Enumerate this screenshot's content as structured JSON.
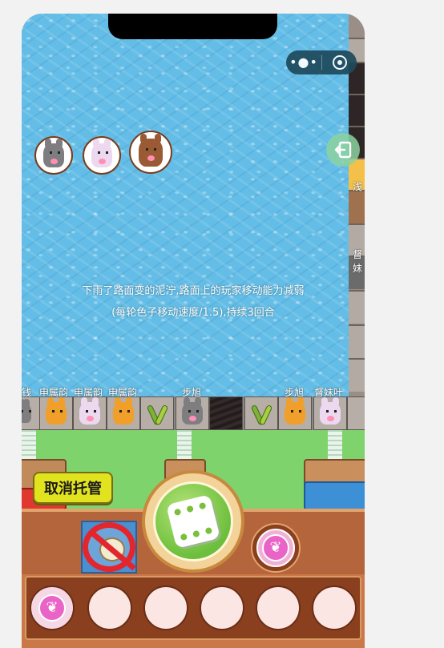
{
  "window": {
    "capsule_menu_icon": "more-dots-icon",
    "capsule_close_icon": "target-circle-icon"
  },
  "event": {
    "line1": "下雨了路面变的泥泞,路面上的玩家移动能力减弱",
    "line2": "(每轮色子移动速度/1.5),持续3回合"
  },
  "right_labels": [
    "浅",
    "督妹"
  ],
  "road_labels": [
    "钱",
    "申属韵",
    "申属韵",
    "申属韵",
    "步旭",
    "步旭",
    "督妹叶"
  ],
  "buttons": {
    "cancel_auto": "取消托管"
  },
  "inventory": {
    "slots": 6,
    "filled_slots": 1
  },
  "colors": {
    "water": "#63bde6",
    "grass": "#7fd36c",
    "panel": "#b5653b",
    "cancel_button": "#e2e31f",
    "prop": "#ea64c8"
  }
}
